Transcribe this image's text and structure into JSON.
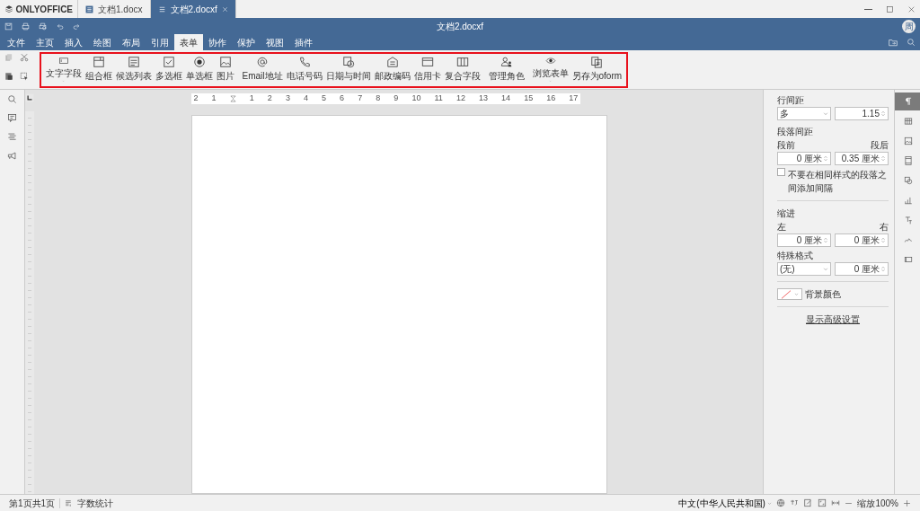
{
  "app": {
    "logo": "ONLYOFFICE"
  },
  "doc_tabs": [
    {
      "label": "文档1.docx",
      "selected": false
    },
    {
      "label": "文档2.docxf",
      "selected": true
    }
  ],
  "window": {
    "title": "文档2.docxf",
    "avatar": "周"
  },
  "menu": [
    {
      "label": "文件",
      "selected": false
    },
    {
      "label": "主页",
      "selected": false
    },
    {
      "label": "插入",
      "selected": false
    },
    {
      "label": "绘图",
      "selected": false
    },
    {
      "label": "布局",
      "selected": false
    },
    {
      "label": "引用",
      "selected": false
    },
    {
      "label": "表单",
      "selected": true
    },
    {
      "label": "协作",
      "selected": false
    },
    {
      "label": "保护",
      "selected": false
    },
    {
      "label": "视图",
      "selected": false
    },
    {
      "label": "插件",
      "selected": false
    }
  ],
  "toolbar_groups": [
    [
      {
        "label": "文字字段",
        "dropdown": true
      },
      {
        "label": "组合框",
        "dropdown": false
      },
      {
        "label": "候选列表",
        "dropdown": false
      },
      {
        "label": "多选框",
        "dropdown": false
      },
      {
        "label": "单选框",
        "dropdown": false
      },
      {
        "label": "图片",
        "dropdown": false
      }
    ],
    [
      {
        "label": "Email地址",
        "dropdown": false
      },
      {
        "label": "电话号码",
        "dropdown": false
      },
      {
        "label": "日期与时间",
        "dropdown": false
      },
      {
        "label": "邮政编码",
        "dropdown": false
      },
      {
        "label": "信用卡",
        "dropdown": false
      },
      {
        "label": "复合字段",
        "dropdown": false
      }
    ],
    [
      {
        "label": "管理角色",
        "dropdown": false
      }
    ],
    [
      {
        "label": "浏览表单",
        "dropdown": true
      },
      {
        "label": "另存为oform",
        "dropdown": false
      }
    ]
  ],
  "ruler_numbers": [
    "2",
    "1",
    "1",
    "2",
    "3",
    "4",
    "5",
    "6",
    "7",
    "8",
    "9",
    "10",
    "11",
    "12",
    "13",
    "14",
    "15",
    "16",
    "17"
  ],
  "panel": {
    "line_spacing_label": "行间距",
    "line_spacing_mode": "多",
    "line_spacing_value": "1.15",
    "para_spacing_label": "段落间距",
    "before_label": "段前",
    "before_value": "0 厘米",
    "after_label": "段后",
    "after_value": "0.35 厘米",
    "no_space_checkbox": {
      "label": "不要在相同样式的段落之间添加间隔",
      "checked": false
    },
    "indent_label": "缩进",
    "left_label": "左",
    "left_value": "0 厘米",
    "right_label": "右",
    "right_value": "0 厘米",
    "special_label": "特殊格式",
    "special_mode": "(无)",
    "special_value": "0 厘米",
    "background_label": "背景颜色",
    "advanced_link": "显示高级设置"
  },
  "right_tabs": [
    {
      "selected": true
    },
    {
      "selected": false
    },
    {
      "selected": false
    },
    {
      "selected": false
    },
    {
      "selected": false
    },
    {
      "selected": false
    },
    {
      "selected": false
    },
    {
      "selected": false
    },
    {
      "selected": false
    }
  ],
  "status_bar": {
    "page": "第1页共1页",
    "word_count": "字数统计",
    "language": "中文(中华人民共和国)",
    "zoom": "缩放100%"
  }
}
